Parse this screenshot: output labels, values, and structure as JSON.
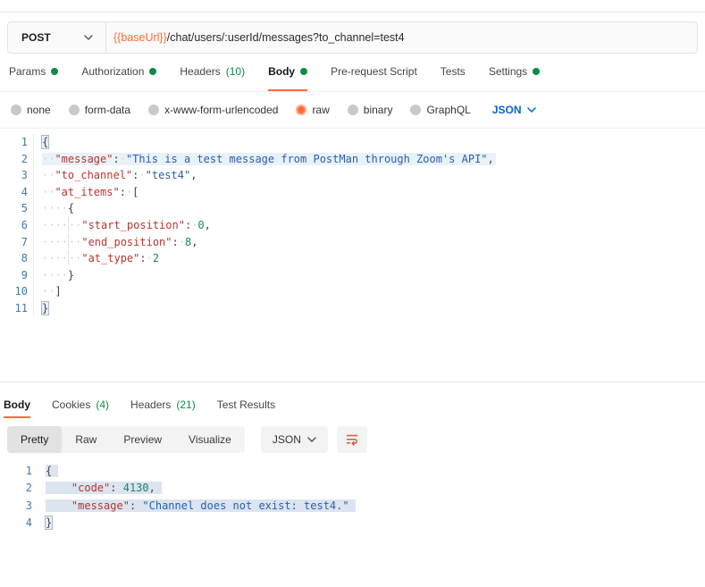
{
  "colors": {
    "accent_orange": "#ff6c37",
    "success_green": "#0f8a47",
    "link_blue": "#0265d2",
    "icon_orange": "#d9573f",
    "line_number": "#4878a8"
  },
  "syntax": {
    "syn_key": "#b8362f",
    "syn_string": "#2b5fad",
    "syn_number": "#17876b",
    "syn_punc": "#3f4752"
  },
  "request": {
    "method": "POST",
    "url": {
      "base": "{{baseUrl}}",
      "path": "/chat/users/:userId/messages?to_channel=test4"
    },
    "tabs": [
      {
        "label": "Params",
        "indicator": "dot"
      },
      {
        "label": "Authorization",
        "indicator": "dot"
      },
      {
        "label": "Headers",
        "count": "(10)"
      },
      {
        "label": "Body",
        "indicator": "dot",
        "active": true
      },
      {
        "label": "Pre-request Script"
      },
      {
        "label": "Tests"
      },
      {
        "label": "Settings",
        "indicator": "dot"
      }
    ],
    "body_types": [
      "none",
      "form-data",
      "x-www-form-urlencoded",
      "raw",
      "binary",
      "GraphQL"
    ],
    "body_type_selected": "raw",
    "raw_language": "JSON"
  },
  "request_editor": {
    "lines": [
      {
        "n": "1",
        "tk": [
          {
            "t": "cursor",
            "v": ""
          },
          {
            "t": "punc",
            "v": "{",
            "box": true
          }
        ]
      },
      {
        "n": "2",
        "sel": true,
        "tk": [
          {
            "t": "ws",
            "v": "  "
          },
          {
            "t": "key",
            "v": "\"message\""
          },
          {
            "t": "punc",
            "v": ":"
          },
          {
            "t": "ws",
            "v": " "
          },
          {
            "t": "str",
            "v": "\"This is a test message from PostMan through Zoom's API\""
          },
          {
            "t": "punc",
            "v": ","
          }
        ]
      },
      {
        "n": "3",
        "tk": [
          {
            "t": "ws",
            "v": "  "
          },
          {
            "t": "key",
            "v": "\"to_channel\""
          },
          {
            "t": "punc",
            "v": ":"
          },
          {
            "t": "ws",
            "v": " "
          },
          {
            "t": "str",
            "v": "\"test4\""
          },
          {
            "t": "punc",
            "v": ","
          }
        ]
      },
      {
        "n": "4",
        "tk": [
          {
            "t": "ws",
            "v": "  "
          },
          {
            "t": "key",
            "v": "\"at_items\""
          },
          {
            "t": "punc",
            "v": ":"
          },
          {
            "t": "ws",
            "v": " "
          },
          {
            "t": "punc",
            "v": "["
          }
        ]
      },
      {
        "n": "5",
        "tk": [
          {
            "t": "ws",
            "v": "    "
          },
          {
            "t": "punc",
            "v": "{"
          }
        ]
      },
      {
        "n": "6",
        "tk": [
          {
            "t": "ws",
            "v": "    "
          },
          {
            "t": "guide",
            "v": ""
          },
          {
            "t": "ws",
            "v": "  "
          },
          {
            "t": "key",
            "v": "\"start_position\""
          },
          {
            "t": "punc",
            "v": ":"
          },
          {
            "t": "ws",
            "v": " "
          },
          {
            "t": "num",
            "v": "0"
          },
          {
            "t": "punc",
            "v": ","
          }
        ]
      },
      {
        "n": "7",
        "tk": [
          {
            "t": "ws",
            "v": "    "
          },
          {
            "t": "guide",
            "v": ""
          },
          {
            "t": "ws",
            "v": "  "
          },
          {
            "t": "key",
            "v": "\"end_position\""
          },
          {
            "t": "punc",
            "v": ":"
          },
          {
            "t": "ws",
            "v": " "
          },
          {
            "t": "num",
            "v": "8"
          },
          {
            "t": "punc",
            "v": ","
          }
        ]
      },
      {
        "n": "8",
        "tk": [
          {
            "t": "ws",
            "v": "    "
          },
          {
            "t": "guide",
            "v": ""
          },
          {
            "t": "ws",
            "v": "  "
          },
          {
            "t": "key",
            "v": "\"at_type\""
          },
          {
            "t": "punc",
            "v": ":"
          },
          {
            "t": "ws",
            "v": " "
          },
          {
            "t": "num",
            "v": "2"
          }
        ]
      },
      {
        "n": "9",
        "tk": [
          {
            "t": "ws",
            "v": "    "
          },
          {
            "t": "punc",
            "v": "}"
          }
        ]
      },
      {
        "n": "10",
        "tk": [
          {
            "t": "ws",
            "v": "  "
          },
          {
            "t": "punc",
            "v": "]"
          }
        ]
      },
      {
        "n": "11",
        "tk": [
          {
            "t": "punc",
            "v": "}",
            "box": true
          }
        ]
      }
    ]
  },
  "response": {
    "tabs": [
      {
        "label": "Body",
        "active": true
      },
      {
        "label": "Cookies",
        "count": "(4)"
      },
      {
        "label": "Headers",
        "count": "(21)"
      },
      {
        "label": "Test Results"
      }
    ],
    "views": [
      "Pretty",
      "Raw",
      "Preview",
      "Visualize"
    ],
    "active_view": "Pretty",
    "language": "JSON",
    "editor": {
      "lines": [
        {
          "n": "1",
          "sel": true,
          "tk": [
            {
              "t": "punc",
              "v": "{"
            }
          ]
        },
        {
          "n": "2",
          "sel": true,
          "tk": [
            {
              "t": "ws",
              "v": "    "
            },
            {
              "t": "key",
              "v": "\"code\""
            },
            {
              "t": "punc",
              "v": ":"
            },
            {
              "t": "ws",
              "v": " "
            },
            {
              "t": "num",
              "v": "4130"
            },
            {
              "t": "punc",
              "v": ","
            }
          ]
        },
        {
          "n": "3",
          "sel": true,
          "tk": [
            {
              "t": "ws",
              "v": "    "
            },
            {
              "t": "key",
              "v": "\"message\""
            },
            {
              "t": "punc",
              "v": ":"
            },
            {
              "t": "ws",
              "v": " "
            },
            {
              "t": "str",
              "v": "\"Channel does not exist: test4.\""
            }
          ]
        },
        {
          "n": "4",
          "tk": [
            {
              "t": "punc",
              "v": "}",
              "box": true
            }
          ]
        }
      ]
    }
  }
}
